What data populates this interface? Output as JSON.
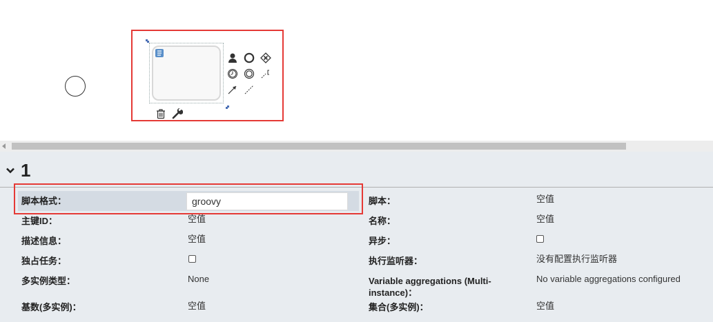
{
  "panel": {
    "title": "1"
  },
  "props": {
    "script_format": {
      "label": "脚本格式：",
      "value": "groovy"
    },
    "script": {
      "label": "脚本：",
      "value": "空值"
    },
    "id": {
      "label": "主键ID：",
      "value": "空值"
    },
    "name": {
      "label": "名称：",
      "value": "空值"
    },
    "documentation": {
      "label": "描述信息：",
      "value": "空值"
    },
    "async": {
      "label": "异步：",
      "checked": false
    },
    "exclusive": {
      "label": "独占任务：",
      "checked": false
    },
    "listeners": {
      "label": "执行监听器：",
      "value": "没有配置执行监听器"
    },
    "multi_instance_type": {
      "label": "多实例类型：",
      "value": "None"
    },
    "variable_aggregations": {
      "label_line1": "Variable aggregations (Multi-",
      "label_line2": "instance)：",
      "value": "No variable aggregations configured"
    },
    "cardinality": {
      "label": "基数(多实例)：",
      "value": "空值"
    },
    "collection": {
      "label": "集合(多实例)：",
      "value": "空值"
    }
  },
  "colors": {
    "highlight": "#e53935",
    "panel_bg": "#e8ecf0",
    "script_icon": "#5a8fc9"
  },
  "icons": [
    "script-task-icon",
    "user-task-icon",
    "end-event-icon",
    "gateway-icon",
    "intermediate-timer-icon",
    "intermediate-event-icon",
    "annotation-icon",
    "sequence-flow-icon",
    "association-icon",
    "delete-icon",
    "wrench-icon",
    "chevron-down-icon"
  ]
}
